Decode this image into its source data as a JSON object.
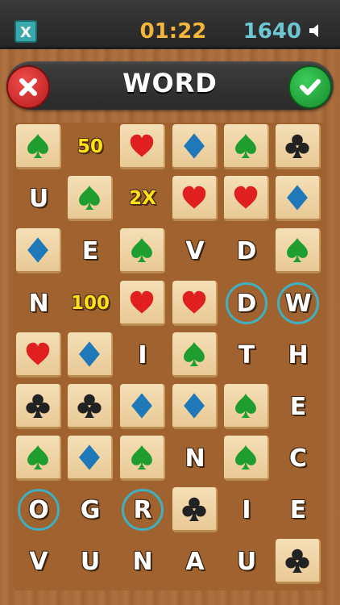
{
  "header": {
    "close_label": "X",
    "timer": "01:22",
    "score": "1640",
    "sound_icon": "speaker-icon"
  },
  "word_bar": {
    "current_word": "WORD",
    "reject_icon": "x-icon",
    "accept_icon": "checkmark-icon"
  },
  "colors": {
    "spade": "#1f9e2f",
    "heart": "#e02020",
    "diamond": "#1f78b8",
    "club": "#222222",
    "bonus": "#ffe11a",
    "selection_ring": "#3fb0c4",
    "timer": "#f4b63a",
    "score": "#6cc7d3"
  },
  "board": {
    "rows": [
      [
        {
          "type": "suit",
          "suit": "spade"
        },
        {
          "type": "bonus",
          "value": "50"
        },
        {
          "type": "suit",
          "suit": "heart"
        },
        {
          "type": "suit",
          "suit": "diamond"
        },
        {
          "type": "suit",
          "suit": "spade"
        },
        {
          "type": "suit",
          "suit": "club"
        }
      ],
      [
        {
          "type": "letter",
          "value": "U"
        },
        {
          "type": "suit",
          "suit": "spade"
        },
        {
          "type": "bonus",
          "value": "2X"
        },
        {
          "type": "suit",
          "suit": "heart"
        },
        {
          "type": "suit",
          "suit": "heart"
        },
        {
          "type": "suit",
          "suit": "diamond"
        }
      ],
      [
        {
          "type": "suit",
          "suit": "diamond"
        },
        {
          "type": "letter",
          "value": "E"
        },
        {
          "type": "suit",
          "suit": "spade"
        },
        {
          "type": "letter",
          "value": "V"
        },
        {
          "type": "letter",
          "value": "D"
        },
        {
          "type": "suit",
          "suit": "spade"
        }
      ],
      [
        {
          "type": "letter",
          "value": "N"
        },
        {
          "type": "bonus",
          "value": "100"
        },
        {
          "type": "suit",
          "suit": "heart"
        },
        {
          "type": "suit",
          "suit": "heart"
        },
        {
          "type": "letter",
          "value": "D",
          "selected": true
        },
        {
          "type": "letter",
          "value": "W",
          "selected": true
        }
      ],
      [
        {
          "type": "suit",
          "suit": "heart"
        },
        {
          "type": "suit",
          "suit": "diamond"
        },
        {
          "type": "letter",
          "value": "I"
        },
        {
          "type": "suit",
          "suit": "spade"
        },
        {
          "type": "letter",
          "value": "T"
        },
        {
          "type": "letter",
          "value": "H"
        }
      ],
      [
        {
          "type": "suit",
          "suit": "club"
        },
        {
          "type": "suit",
          "suit": "club"
        },
        {
          "type": "suit",
          "suit": "diamond"
        },
        {
          "type": "suit",
          "suit": "diamond"
        },
        {
          "type": "suit",
          "suit": "spade"
        },
        {
          "type": "letter",
          "value": "E"
        }
      ],
      [
        {
          "type": "suit",
          "suit": "spade"
        },
        {
          "type": "suit",
          "suit": "diamond"
        },
        {
          "type": "suit",
          "suit": "spade"
        },
        {
          "type": "letter",
          "value": "N"
        },
        {
          "type": "suit",
          "suit": "spade"
        },
        {
          "type": "letter",
          "value": "C"
        }
      ],
      [
        {
          "type": "letter",
          "value": "O",
          "selected": true
        },
        {
          "type": "letter",
          "value": "G"
        },
        {
          "type": "letter",
          "value": "R",
          "selected": true
        },
        {
          "type": "suit",
          "suit": "club"
        },
        {
          "type": "letter",
          "value": "I"
        },
        {
          "type": "letter",
          "value": "E"
        }
      ],
      [
        {
          "type": "letter",
          "value": "V"
        },
        {
          "type": "letter",
          "value": "U"
        },
        {
          "type": "letter",
          "value": "N"
        },
        {
          "type": "letter",
          "value": "A"
        },
        {
          "type": "letter",
          "value": "U"
        },
        {
          "type": "suit",
          "suit": "club"
        }
      ]
    ]
  }
}
